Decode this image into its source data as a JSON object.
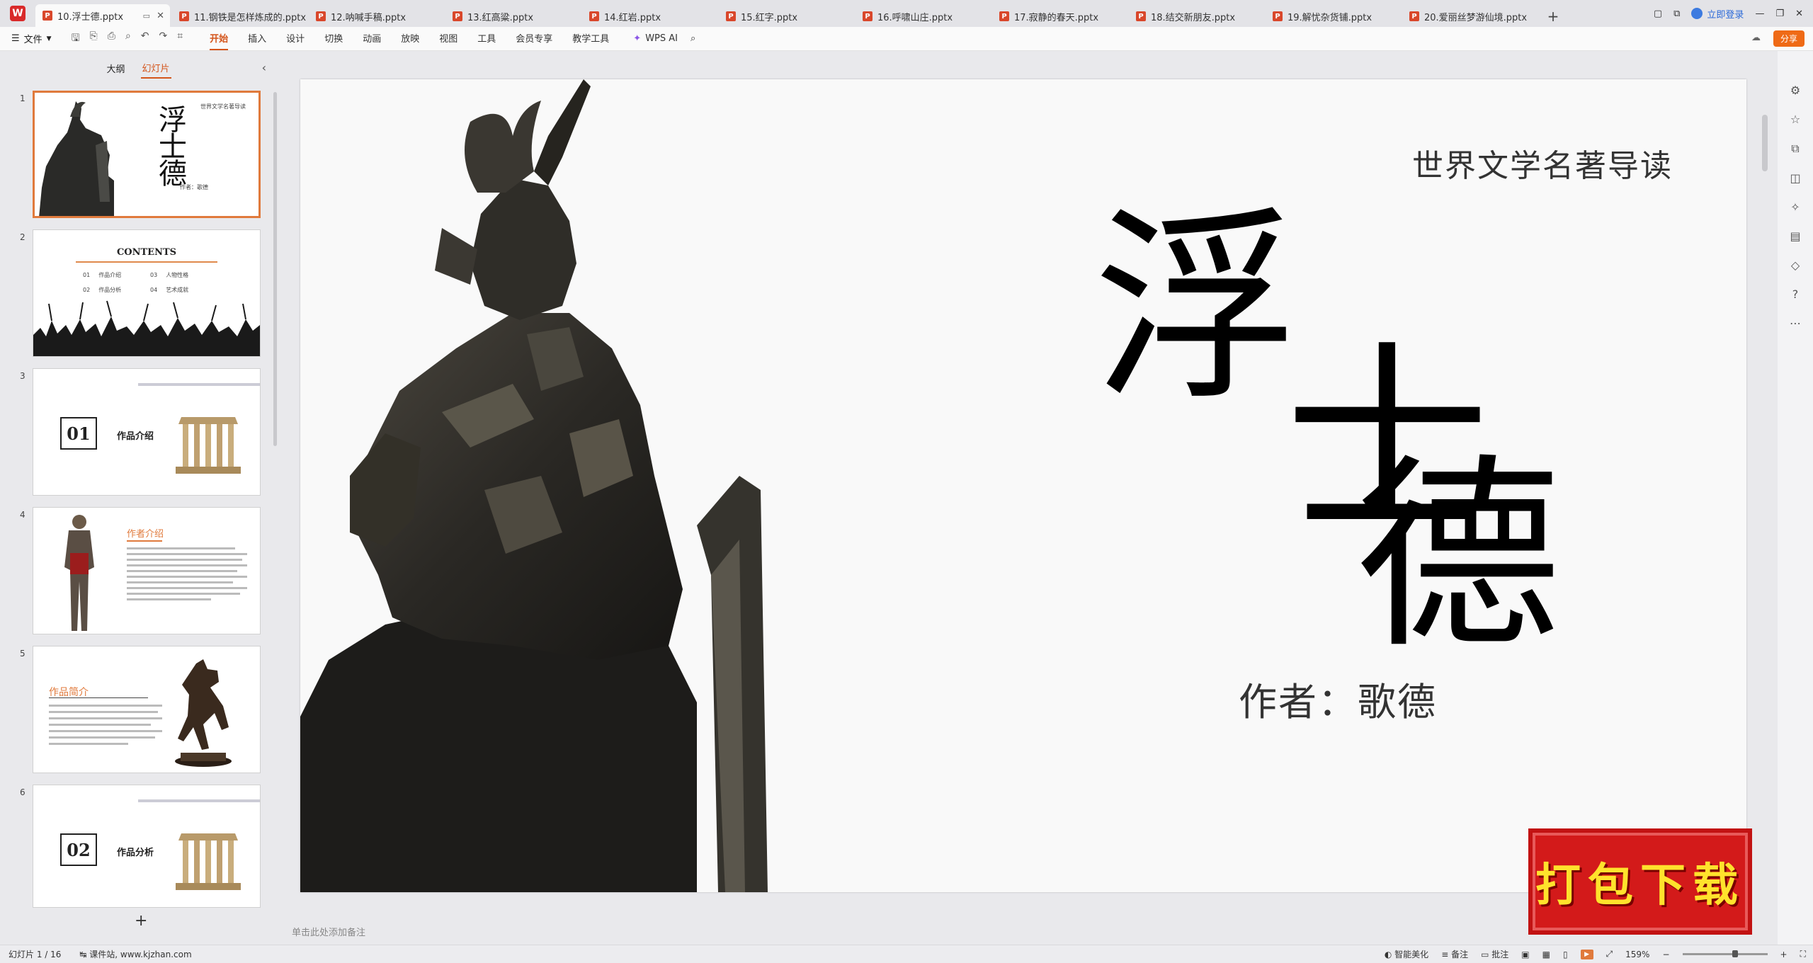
{
  "tabs": [
    {
      "label": "10.浮士德.pptx",
      "active": true
    },
    {
      "label": "11.钢铁是怎样炼成的.pptx"
    },
    {
      "label": "12.呐喊手稿.pptx"
    },
    {
      "label": "13.红高粱.pptx"
    },
    {
      "label": "14.红岩.pptx"
    },
    {
      "label": "15.红字.pptx"
    },
    {
      "label": "16.呼啸山庄.pptx"
    },
    {
      "label": "17.寂静的春天.pptx"
    },
    {
      "label": "18.结交新朋友.pptx"
    },
    {
      "label": "19.解忧杂货铺.pptx"
    },
    {
      "label": "20.爱丽丝梦游仙境.pptx"
    }
  ],
  "topright": {
    "login": "立即登录"
  },
  "ribbon": {
    "file": "文件",
    "menus": [
      "开始",
      "插入",
      "设计",
      "切换",
      "动画",
      "放映",
      "视图",
      "工具",
      "会员专享",
      "教学工具"
    ],
    "active_menu": "开始",
    "wps_ai": "WPS AI",
    "share": "分享"
  },
  "sidebar": {
    "tabs": [
      "大纲",
      "幻灯片"
    ],
    "active_tab": "幻灯片",
    "slides": [
      {
        "num": "1",
        "title": "浮士德",
        "subtitle": "世界文学名著导读",
        "author": "作者：歌德"
      },
      {
        "num": "2",
        "heading": "CONTENTS",
        "items": [
          [
            "01",
            "作品介绍"
          ],
          [
            "03",
            "人物性格"
          ],
          [
            "02",
            "作品分析"
          ],
          [
            "04",
            "艺术成就"
          ]
        ]
      },
      {
        "num": "3",
        "box": "01",
        "label": "作品介绍"
      },
      {
        "num": "4",
        "title": "作者介绍"
      },
      {
        "num": "5",
        "title": "作品简介"
      },
      {
        "num": "6",
        "box": "02",
        "label": "作品分析"
      }
    ]
  },
  "slide": {
    "subtitle": "世界文学名著导读",
    "title_chars": [
      "浮",
      "士",
      "德"
    ],
    "author": "作者：歌德"
  },
  "notes_placeholder": "单击此处添加备注",
  "stamp": "打包下载",
  "status": {
    "slide_count": "幻灯片 1 / 16",
    "source": "课件站, www.kjzhan.com",
    "smart": "智能美化",
    "notes": "备注",
    "comments": "批注",
    "zoom": "159%"
  }
}
